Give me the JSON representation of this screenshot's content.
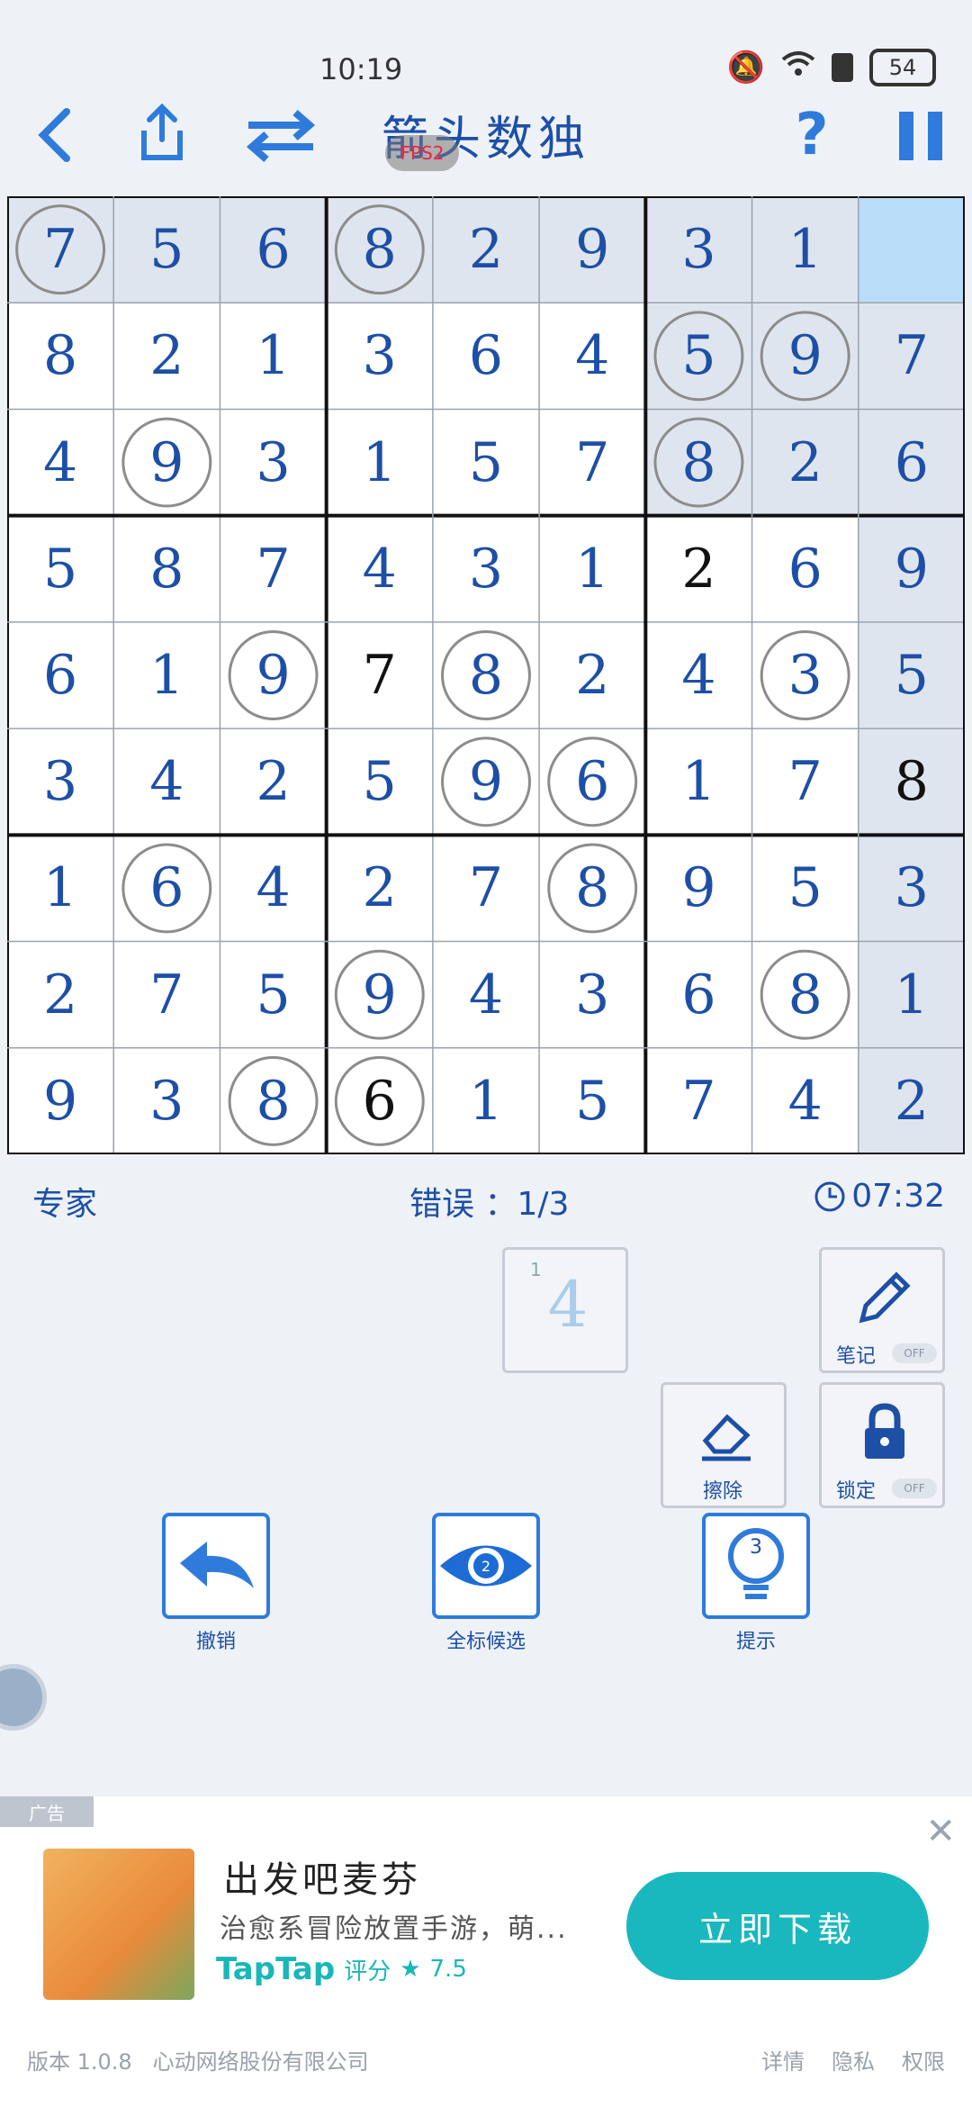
{
  "status_bar": {
    "time": "10:19",
    "battery": "54"
  },
  "header": {
    "title": "箭头数独",
    "fps_badge": "FPS2"
  },
  "board": {
    "cells": [
      [
        "7",
        "5",
        "6",
        "8",
        "2",
        "9",
        "3",
        "1",
        ""
      ],
      [
        "8",
        "2",
        "1",
        "3",
        "6",
        "4",
        "5",
        "9",
        "7"
      ],
      [
        "4",
        "9",
        "3",
        "1",
        "5",
        "7",
        "8",
        "2",
        "6"
      ],
      [
        "5",
        "8",
        "7",
        "4",
        "3",
        "1",
        "2",
        "6",
        "9"
      ],
      [
        "6",
        "1",
        "9",
        "7",
        "8",
        "2",
        "4",
        "3",
        "5"
      ],
      [
        "3",
        "4",
        "2",
        "5",
        "9",
        "6",
        "1",
        "7",
        "8"
      ],
      [
        "1",
        "6",
        "4",
        "2",
        "7",
        "8",
        "9",
        "5",
        "3"
      ],
      [
        "2",
        "7",
        "5",
        "9",
        "4",
        "3",
        "6",
        "8",
        "1"
      ],
      [
        "9",
        "3",
        "8",
        "6",
        "1",
        "5",
        "7",
        "4",
        "2"
      ]
    ],
    "circled_cells": [
      [
        0,
        0
      ],
      [
        0,
        3
      ],
      [
        1,
        6
      ],
      [
        1,
        7
      ],
      [
        2,
        1
      ],
      [
        2,
        6
      ],
      [
        4,
        2
      ],
      [
        4,
        4
      ],
      [
        4,
        7
      ],
      [
        5,
        4
      ],
      [
        5,
        5
      ],
      [
        6,
        1
      ],
      [
        6,
        5
      ],
      [
        7,
        3
      ],
      [
        7,
        7
      ],
      [
        8,
        2
      ],
      [
        8,
        3
      ]
    ],
    "black_digit_cells": [
      [
        3,
        6
      ],
      [
        4,
        3
      ],
      [
        5,
        8
      ],
      [
        8,
        3
      ]
    ],
    "selected_cell": [
      0,
      8
    ],
    "highlight_color": "#dfe5ee",
    "selected_color": "#b9dcf8",
    "digit_color": "#1d4fa6"
  },
  "info": {
    "difficulty": "专家",
    "errors_label": "错误 ：",
    "errors_value": "1/3",
    "timer": "07:32"
  },
  "note_preview": {
    "small": "1",
    "digit": "4"
  },
  "tools": {
    "notes": {
      "label": "笔记",
      "toggle": "OFF"
    },
    "erase": {
      "label": "擦除"
    },
    "lock": {
      "label": "锁定",
      "toggle": "OFF"
    }
  },
  "actions": {
    "undo": {
      "label": "撤销"
    },
    "candidates": {
      "label": "全标候选",
      "count": "2"
    },
    "hint": {
      "label": "提示",
      "count": "3"
    }
  },
  "ad": {
    "tag": "广告",
    "title": "出发吧麦芬",
    "description": "治愈系冒险放置手游，萌...",
    "brand": "TapTap",
    "rating_label": "评分",
    "rating": "7.5",
    "cta": "立即下载"
  },
  "footer": {
    "version": "版本 1.0.8",
    "company": "心动网络股份有限公司",
    "links": [
      "详情",
      "隐私",
      "权限"
    ]
  }
}
